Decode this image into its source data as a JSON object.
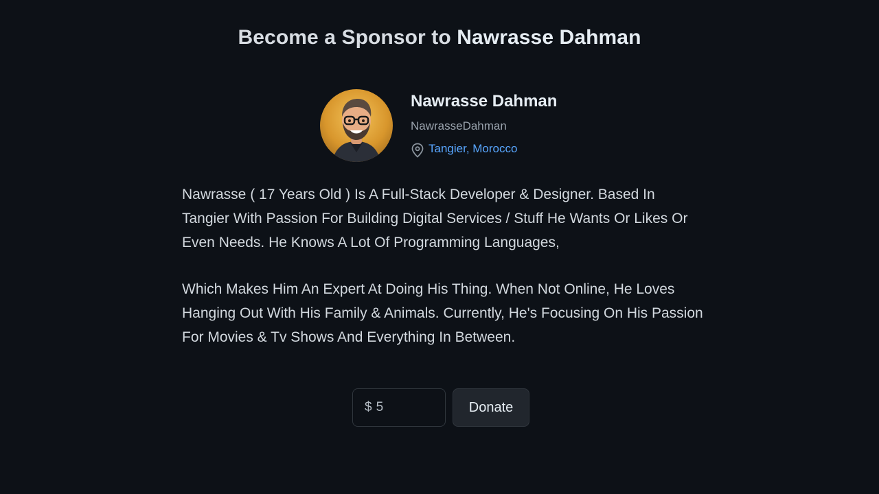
{
  "header": {
    "title_prefix": "Become a Sponsor to",
    "title_name": "Nawrasse Dahman"
  },
  "profile": {
    "display_name": "Nawrasse Dahman",
    "username": "NawrasseDahman",
    "location": "Tangier, Morocco",
    "avatar_icon": "memoji-avatar",
    "location_icon": "map-pin-icon",
    "link_color": "#58a6ff"
  },
  "bio": {
    "paragraphs": [
      "Nawrasse ( 17 Years Old ) Is A Full-Stack Developer & Designer. Based In Tangier With Passion For Building Digital Services / Stuff He Wants Or Likes Or Even Needs. He Knows A Lot Of Programming Languages,",
      "Which Makes Him An Expert At Doing His Thing. When Not Online, He Loves Hanging Out With His Family & Animals. Currently, He's Focusing On His Passion For Movies & Tv Shows And Everything In Between."
    ]
  },
  "donation": {
    "currency_symbol": "$",
    "amount_value": "5",
    "button_label": "Donate"
  },
  "colors": {
    "background": "#0d1117",
    "button_bg": "#21262d",
    "border": "#30363d"
  }
}
